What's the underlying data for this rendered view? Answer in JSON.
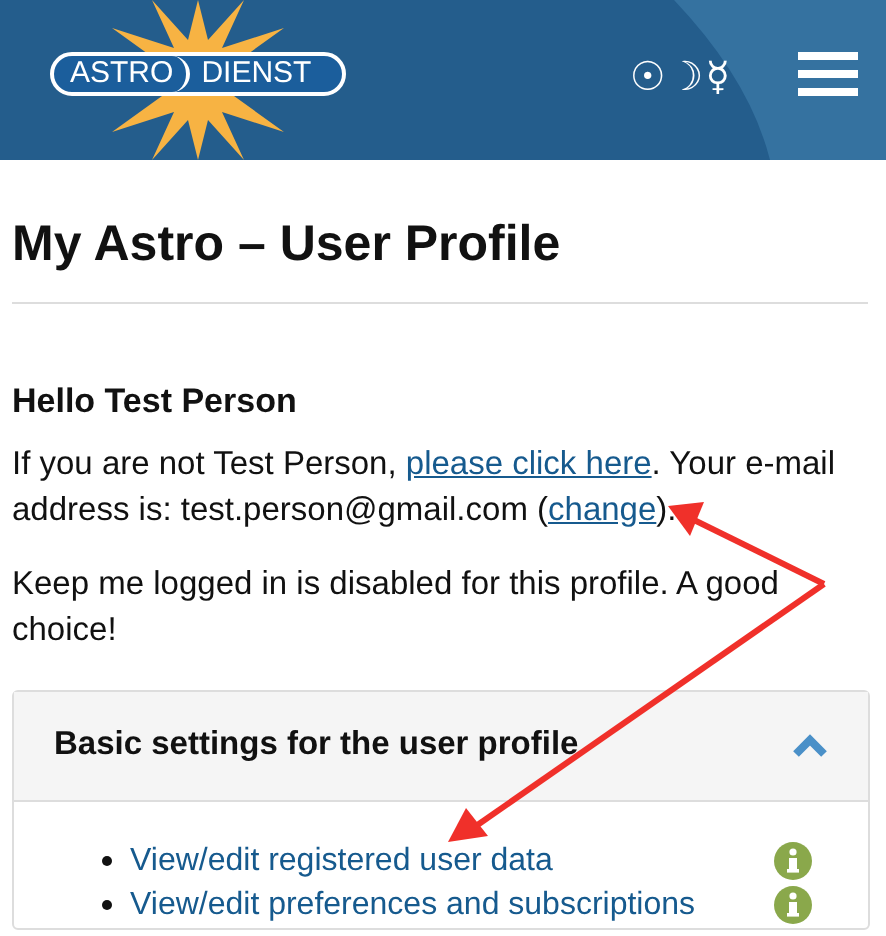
{
  "header": {
    "logo": {
      "left": "ASTRO",
      "right": "DIENST"
    },
    "symbols": [
      "☉",
      "☽",
      "☿"
    ]
  },
  "page_title": "My Astro – User Profile",
  "greeting": "Hello Test Person",
  "paragraphs": [
    [
      {
        "kind": "text",
        "text": "If you are not Test Person, "
      },
      {
        "kind": "link",
        "text": "please click here"
      },
      {
        "kind": "text",
        "text": ". Your e-mail address is: test.person@gmail.com ("
      },
      {
        "kind": "link",
        "text": "change"
      },
      {
        "kind": "text",
        "text": ")."
      }
    ],
    [
      {
        "kind": "text",
        "text": "Keep me logged in is disabled for this profile. A good choice!"
      }
    ]
  ],
  "card": {
    "title": "Basic settings for the user profile",
    "expanded": true,
    "items": [
      {
        "label": "View/edit registered user data"
      },
      {
        "label": "View/edit preferences and subscriptions"
      }
    ]
  }
}
